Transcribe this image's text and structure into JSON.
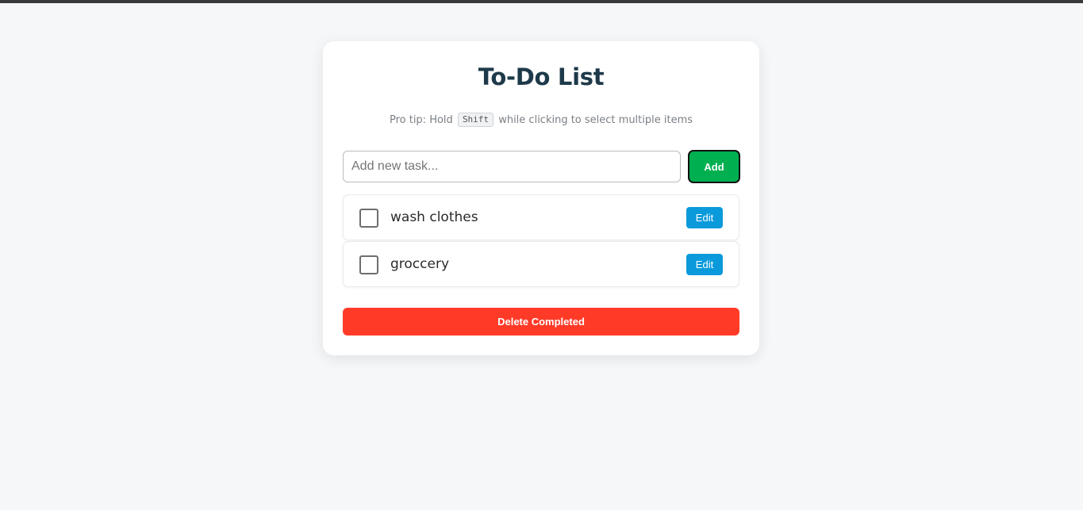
{
  "app": {
    "title": "To-Do List",
    "tip_prefix": "Pro tip: Hold",
    "tip_key": "Shift",
    "tip_suffix": "while clicking to select multiple items"
  },
  "input": {
    "placeholder": "Add new task...",
    "value": ""
  },
  "add_button": {
    "label": "Add",
    "color": "#00b050"
  },
  "todos": [
    {
      "text": "wash clothes",
      "checked": false,
      "edit_label": "Edit"
    },
    {
      "text": "groccery",
      "checked": false,
      "edit_label": "Edit"
    }
  ],
  "delete_button": {
    "label": "Delete Completed",
    "color": "#ff3b28"
  },
  "colors": {
    "title": "#1e3a4a",
    "edit_button": "#0a9adb",
    "background": "#f5f7f9"
  }
}
